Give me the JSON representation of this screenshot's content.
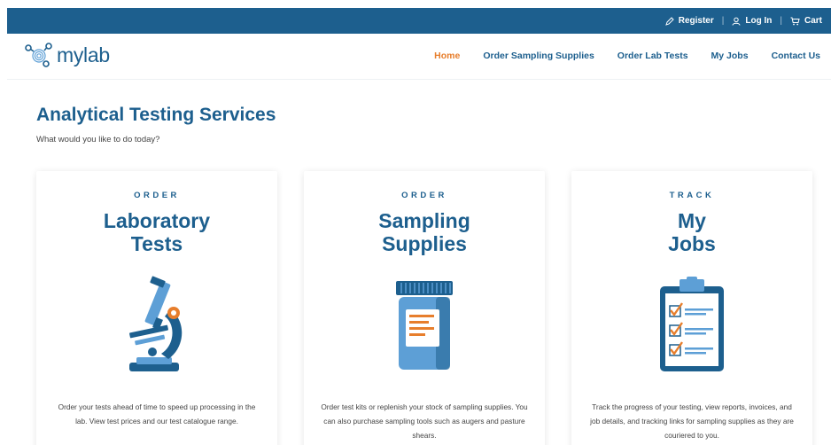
{
  "topbar": {
    "register_label": "Register",
    "login_label": "Log In",
    "cart_label": "Cart",
    "separator": "|"
  },
  "brand": {
    "logo_text": "mylab"
  },
  "nav": {
    "home": "Home",
    "order_sampling_supplies": "Order Sampling Supplies",
    "order_lab_tests": "Order Lab Tests",
    "my_jobs": "My Jobs",
    "contact_us": "Contact Us"
  },
  "main": {
    "title": "Analytical Testing Services",
    "subtitle": "What would you like to do today?"
  },
  "cards": [
    {
      "eyebrow": "ORDER",
      "title_line1": "Laboratory",
      "title_line2": "Tests",
      "icon": "microscope-icon",
      "description": "Order your tests ahead of time to speed up processing in the lab. View test prices and our test catalogue range."
    },
    {
      "eyebrow": "ORDER",
      "title_line1": "Sampling",
      "title_line2": "Supplies",
      "icon": "sample-jar-icon",
      "description": "Order test kits or replenish your stock of sampling supplies. You can also purchase sampling tools such as augers and pasture shears."
    },
    {
      "eyebrow": "TRACK",
      "title_line1": "My",
      "title_line2": "Jobs",
      "icon": "clipboard-checklist-icon",
      "description": "Track the progress of your testing, view reports, invoices, and job details, and tracking links for sampling supplies as they are couriered to you."
    }
  ],
  "colors": {
    "brand_blue": "#1d5f8e",
    "accent_orange": "#e77e2c",
    "light_blue": "#5d9fd6"
  }
}
